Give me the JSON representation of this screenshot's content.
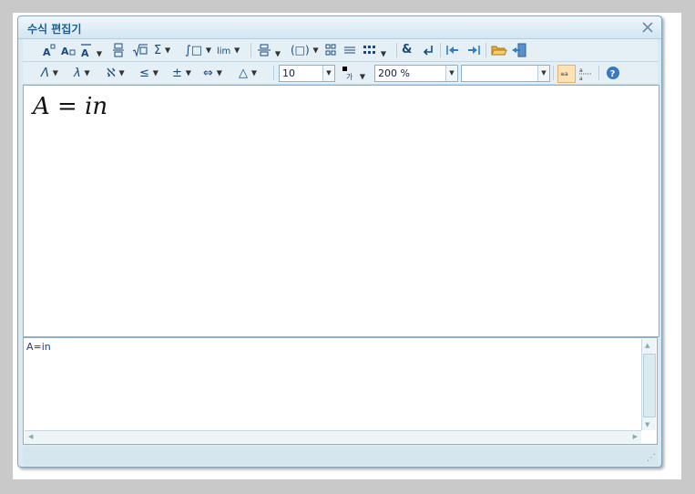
{
  "dialog": {
    "title": "수식 편집기"
  },
  "toolbar": {
    "font_size": "10",
    "color_glyph": "가",
    "zoom": "200 %",
    "font_name": ""
  },
  "editor": {
    "formula_lhs": "A",
    "formula_eq": "=",
    "formula_rhs": "in"
  },
  "source": {
    "text": "A=in"
  },
  "colors": {
    "accent": "#1c5f94",
    "panel": "#dbeaf2",
    "border": "#8eb0c6"
  }
}
